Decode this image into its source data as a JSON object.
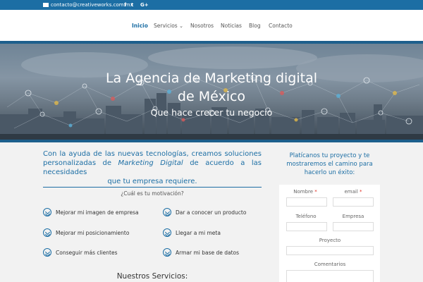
{
  "topbar": {
    "email": "contacto@creativeworks.com.mx",
    "social": [
      "f",
      "t",
      "G+"
    ],
    "icons": [
      "mail-icon",
      "facebook-icon",
      "twitter-icon",
      "google-plus-icon"
    ]
  },
  "nav": {
    "items": [
      {
        "label": "Inicio",
        "active": true
      },
      {
        "label": "Servicios",
        "dropdown": true
      },
      {
        "label": "Nosotros"
      },
      {
        "label": "Noticias"
      },
      {
        "label": "Blog"
      },
      {
        "label": "Contacto"
      }
    ],
    "dropdown_glyph": "⌄"
  },
  "hero": {
    "title_line1": "La Agencia de Marketing digital",
    "title_line2": "de México",
    "subtitle": "Que hace crecer tu negocio"
  },
  "intro": {
    "part1": "Con la ayuda de las nuevas tecnologías, creamos soluciones personalizadas de ",
    "emphasis": "Marketing Digital",
    "part2": " de acuerdo a las necesidades",
    "part3": "que tu empresa requiere."
  },
  "motivation": {
    "question": "¿Cuál es tu motivación?",
    "options": [
      "Mejorar mi imagen de empresa",
      "Dar a conocer un producto",
      "Mejorar mi posicionamiento",
      "Llegar a mi meta",
      "Conseguir más clientes",
      "Armar mi base de datos"
    ]
  },
  "services": {
    "title": "Nuestros Servicios:"
  },
  "form": {
    "title": "Platícanos tu proyecto y te mostraremos el camino para hacerlo un éxito:",
    "fields": {
      "nombre": "Nombre",
      "email": "email",
      "telefono": "Teléfono",
      "empresa": "Empresa",
      "proyecto": "Proyecto",
      "comentarios": "Comentarios"
    },
    "required_mark": "*"
  },
  "colors": {
    "brand_blue": "#1c6ea4",
    "dark_blue": "#1d5f8c",
    "required_red": "#e02b20"
  }
}
